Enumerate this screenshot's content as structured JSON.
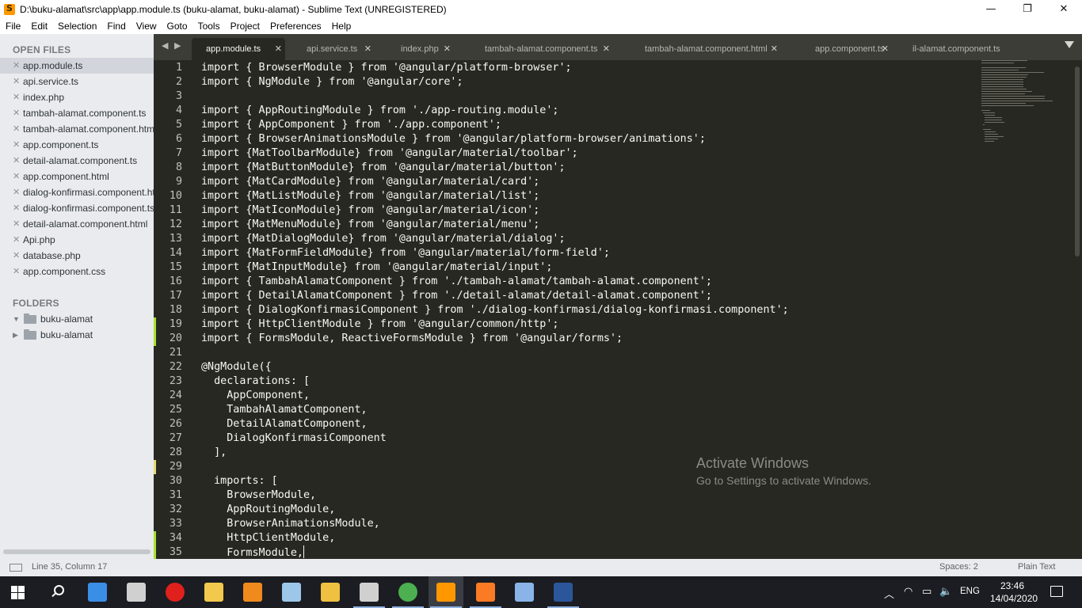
{
  "window": {
    "title": "D:\\buku-alamat\\src\\app\\app.module.ts (buku-alamat, buku-alamat) - Sublime Text (UNREGISTERED)",
    "controls": {
      "minimize": "—",
      "maximize": "❐",
      "close": "✕"
    }
  },
  "menu": [
    "File",
    "Edit",
    "Selection",
    "Find",
    "View",
    "Goto",
    "Tools",
    "Project",
    "Preferences",
    "Help"
  ],
  "sidebar": {
    "open_files_heading": "OPEN FILES",
    "open_files": [
      "app.module.ts",
      "api.service.ts",
      "index.php",
      "tambah-alamat.component.ts",
      "tambah-alamat.component.html",
      "app.component.ts",
      "detail-alamat.component.ts",
      "app.component.html",
      "dialog-konfirmasi.component.html",
      "dialog-konfirmasi.component.ts",
      "detail-alamat.component.html",
      "Api.php",
      "database.php",
      "app.component.css"
    ],
    "close_glyph": "✕",
    "folders_heading": "FOLDERS",
    "folders": [
      {
        "name": "buku-alamat",
        "arrow": "▼"
      },
      {
        "name": "buku-alamat",
        "arrow": "▶"
      }
    ]
  },
  "tabs": {
    "nav": "◀ ▶",
    "items": [
      "app.module.ts",
      "api.service.ts",
      "index.php",
      "tambah-alamat.component.ts",
      "tambah-alamat.component.html",
      "app.component.ts",
      "il-alamat.component.ts"
    ],
    "close_glyph": "✕"
  },
  "editor": {
    "lines": [
      "import { BrowserModule } from '@angular/platform-browser';",
      "import { NgModule } from '@angular/core';",
      "",
      "import { AppRoutingModule } from './app-routing.module';",
      "import { AppComponent } from './app.component';",
      "import { BrowserAnimationsModule } from '@angular/platform-browser/animations';",
      "import {MatToolbarModule} from '@angular/material/toolbar';",
      "import {MatButtonModule} from '@angular/material/button';",
      "import {MatCardModule} from '@angular/material/card';",
      "import {MatListModule} from '@angular/material/list';",
      "import {MatIconModule} from '@angular/material/icon';",
      "import {MatMenuModule} from '@angular/material/menu';",
      "import {MatDialogModule} from '@angular/material/dialog';",
      "import {MatFormFieldModule} from '@angular/material/form-field';",
      "import {MatInputModule} from '@angular/material/input';",
      "import { TambahAlamatComponent } from './tambah-alamat/tambah-alamat.component';",
      "import { DetailAlamatComponent } from './detail-alamat/detail-alamat.component';",
      "import { DialogKonfirmasiComponent } from './dialog-konfirmasi/dialog-konfirmasi.component';",
      "import { HttpClientModule } from '@angular/common/http';",
      "import { FormsModule, ReactiveFormsModule } from '@angular/forms';",
      "",
      "@NgModule({",
      "  declarations: [",
      "    AppComponent,",
      "    TambahAlamatComponent,",
      "    DetailAlamatComponent,",
      "    DialogKonfirmasiComponent",
      "  ],",
      "",
      "  imports: [",
      "    BrowserModule,",
      "    AppRoutingModule,",
      "    BrowserAnimationsModule,",
      "    HttpClientModule,",
      "    FormsModule,"
    ],
    "added_lines": [
      19,
      20,
      34,
      35
    ],
    "modified_lines": [
      29
    ]
  },
  "watermark": {
    "title": "Activate Windows",
    "subtitle": "Go to Settings to activate Windows."
  },
  "status": {
    "position": "Line 35, Column 17",
    "spaces": "Spaces: 2",
    "syntax": "Plain Text"
  },
  "taskbar": {
    "apps": [
      {
        "name": "control-panel-icon",
        "color": "#3a8ee6"
      },
      {
        "name": "calendar-icon",
        "color": "#d0d0d0"
      },
      {
        "name": "opera-icon",
        "color": "#e0201c"
      },
      {
        "name": "file-explorer-icon",
        "color": "#f2c94c"
      },
      {
        "name": "vlc-icon",
        "color": "#f08a1c"
      },
      {
        "name": "notepad-icon",
        "color": "#9cc7e8"
      },
      {
        "name": "git-icon",
        "color": "#f0c040"
      },
      {
        "name": "terminal-icon",
        "color": "#d0d0d0"
      },
      {
        "name": "chrome-icon",
        "color": "#4caf50"
      },
      {
        "name": "sublime-icon",
        "color": "#ff9800"
      },
      {
        "name": "xampp-icon",
        "color": "#fb7a24"
      },
      {
        "name": "virtualbox-icon",
        "color": "#8ab4e8"
      },
      {
        "name": "word-icon",
        "color": "#2b579a"
      }
    ],
    "tray": {
      "chevron": "︿",
      "network": "◠",
      "battery": "▭",
      "volume": "🔈",
      "lang": "ENG",
      "time": "23:46",
      "date": "14/04/2020"
    }
  }
}
